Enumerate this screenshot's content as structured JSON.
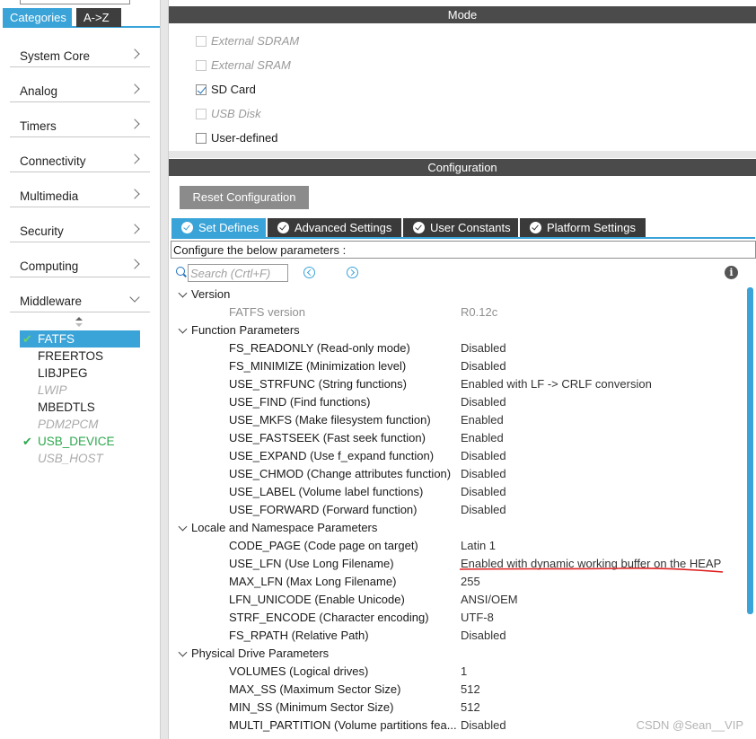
{
  "sidebar": {
    "tabs": [
      "Categories",
      "A->Z"
    ],
    "categories": [
      "System Core",
      "Analog",
      "Timers",
      "Connectivity",
      "Multimedia",
      "Security",
      "Computing",
      "Middleware"
    ],
    "middleware_items": [
      {
        "label": "FATFS",
        "state": "selected-enabled"
      },
      {
        "label": "FREERTOS",
        "state": "normal"
      },
      {
        "label": "LIBJPEG",
        "state": "normal"
      },
      {
        "label": "LWIP",
        "state": "disabled"
      },
      {
        "label": "MBEDTLS",
        "state": "normal"
      },
      {
        "label": "PDM2PCM",
        "state": "disabled"
      },
      {
        "label": "USB_DEVICE",
        "state": "enabled"
      },
      {
        "label": "USB_HOST",
        "state": "disabled"
      }
    ],
    "check_glyph": "✔"
  },
  "mode": {
    "title": "Mode",
    "options": [
      {
        "label": "External SDRAM",
        "checked": false,
        "disabled": true
      },
      {
        "label": "External SRAM",
        "checked": false,
        "disabled": true
      },
      {
        "label": "SD Card",
        "checked": true,
        "disabled": false
      },
      {
        "label": "USB Disk",
        "checked": false,
        "disabled": true
      },
      {
        "label": "User-defined",
        "checked": false,
        "disabled": false
      }
    ]
  },
  "configuration": {
    "title": "Configuration",
    "reset_label": "Reset Configuration",
    "tabs": [
      "Set Defines",
      "Advanced Settings",
      "User Constants",
      "Platform Settings"
    ],
    "active_tab": "Set Defines",
    "hint": "Configure the below parameters :",
    "search_placeholder": "Search (Crtl+F)",
    "info_glyph": "i"
  },
  "tree": {
    "version": {
      "title": "Version",
      "params": [
        {
          "name": "FATFS version",
          "value": "R0.12c",
          "readonly": true
        }
      ]
    },
    "function": {
      "title": "Function Parameters",
      "params": [
        {
          "name": "FS_READONLY (Read-only mode)",
          "value": "Disabled"
        },
        {
          "name": "FS_MINIMIZE (Minimization level)",
          "value": "Disabled"
        },
        {
          "name": "USE_STRFUNC (String functions)",
          "value": "Enabled with LF -> CRLF conversion"
        },
        {
          "name": "USE_FIND (Find functions)",
          "value": "Disabled"
        },
        {
          "name": "USE_MKFS (Make filesystem function)",
          "value": "Enabled"
        },
        {
          "name": "USE_FASTSEEK (Fast seek function)",
          "value": "Enabled"
        },
        {
          "name": "USE_EXPAND (Use f_expand function)",
          "value": "Disabled"
        },
        {
          "name": "USE_CHMOD (Change attributes function)",
          "value": "Disabled"
        },
        {
          "name": "USE_LABEL (Volume label functions)",
          "value": "Disabled"
        },
        {
          "name": "USE_FORWARD (Forward function)",
          "value": "Disabled"
        }
      ]
    },
    "locale": {
      "title": "Locale and Namespace Parameters",
      "params": [
        {
          "name": "CODE_PAGE (Code page on target)",
          "value": "Latin 1"
        },
        {
          "name": "USE_LFN (Use Long Filename)",
          "value": "Enabled with dynamic working buffer on the HEAP"
        },
        {
          "name": "MAX_LFN (Max Long Filename)",
          "value": "255"
        },
        {
          "name": "LFN_UNICODE (Enable Unicode)",
          "value": "ANSI/OEM"
        },
        {
          "name": "STRF_ENCODE (Character encoding)",
          "value": "UTF-8"
        },
        {
          "name": "FS_RPATH (Relative Path)",
          "value": "Disabled"
        }
      ]
    },
    "physical": {
      "title": "Physical Drive Parameters",
      "params": [
        {
          "name": "VOLUMES (Logical drives)",
          "value": "1"
        },
        {
          "name": "MAX_SS (Maximum Sector Size)",
          "value": "512"
        },
        {
          "name": "MIN_SS (Minimum Sector Size)",
          "value": "512"
        },
        {
          "name": "MULTI_PARTITION (Volume partitions fea...",
          "value": "Disabled"
        }
      ]
    }
  },
  "watermark": "CSDN @Sean__VIP",
  "colors": {
    "accent": "#3aa3d8",
    "enabled_green": "#2fa84f",
    "annotation_red": "#e02020",
    "header_dark": "#4b4b4b"
  }
}
